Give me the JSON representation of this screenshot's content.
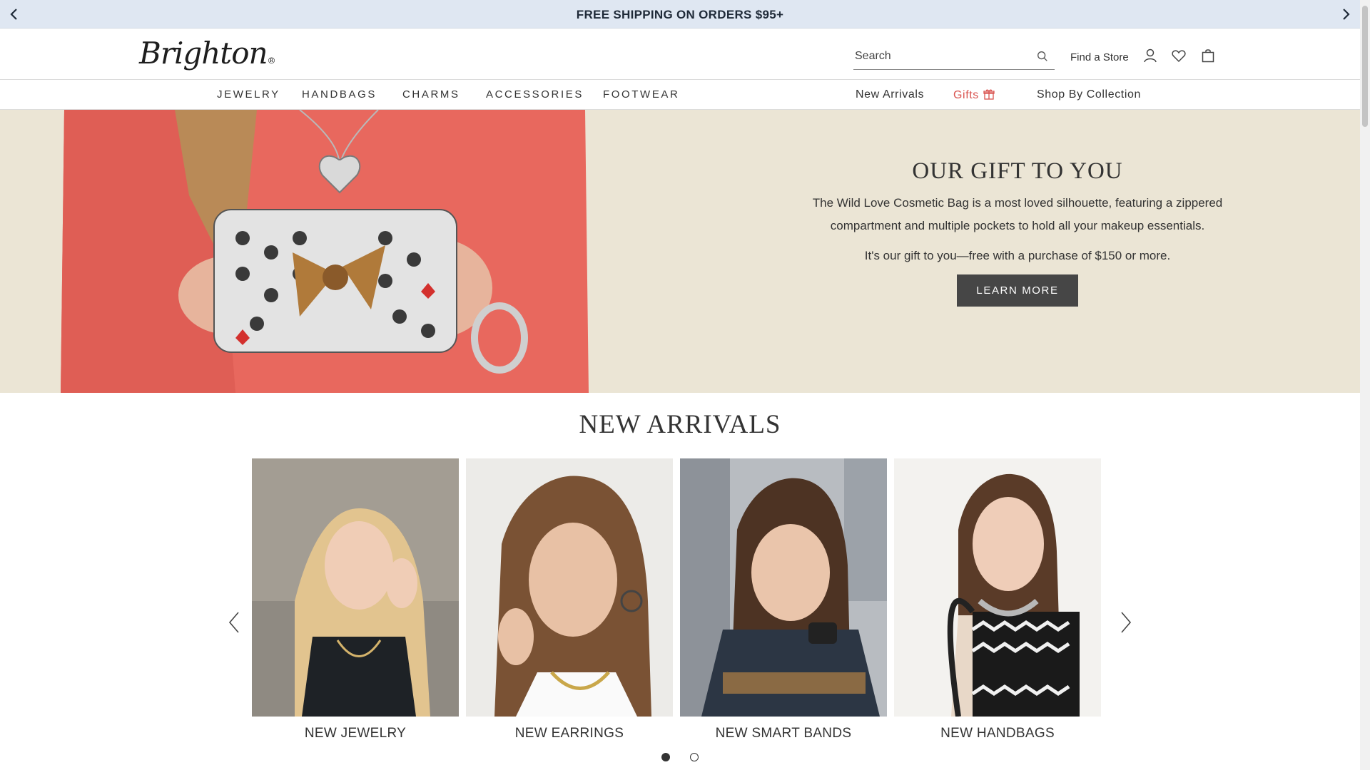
{
  "promo": {
    "text": "FREE SHIPPING ON ORDERS $95+",
    "prev_icon": "chevron-left-icon",
    "next_icon": "chevron-right-icon"
  },
  "header": {
    "logo_text": "Brighton",
    "search_placeholder": "Search",
    "find_store": "Find a Store",
    "icons": [
      "search-icon",
      "account-icon",
      "wishlist-heart-icon",
      "shopping-bag-icon"
    ]
  },
  "nav": {
    "categories": [
      "JEWELRY",
      "HANDBAGS",
      "CHARMS",
      "ACCESSORIES",
      "FOOTWEAR"
    ],
    "new_arrivals": "New Arrivals",
    "gifts": "Gifts",
    "shop_by_collection": "Shop By Collection",
    "gifts_color": "#d9534f"
  },
  "hero": {
    "title": "OUR GIFT TO YOU",
    "body": "The Wild Love Cosmetic Bag is a most loved silhouette, featuring a zippered compartment and multiple pockets to hold all your makeup essentials.",
    "offer": "It's our gift to you—free with a purchase of $150 or more.",
    "cta": "LEARN MORE",
    "background": "#ebe5d5"
  },
  "new_arrivals": {
    "title": "NEW ARRIVALS",
    "cards": [
      {
        "label": "NEW JEWELRY"
      },
      {
        "label": "NEW EARRINGS"
      },
      {
        "label": "NEW SMART BANDS"
      },
      {
        "label": "NEW HANDBAGS"
      }
    ],
    "active_page": 1,
    "page_count": 2
  }
}
